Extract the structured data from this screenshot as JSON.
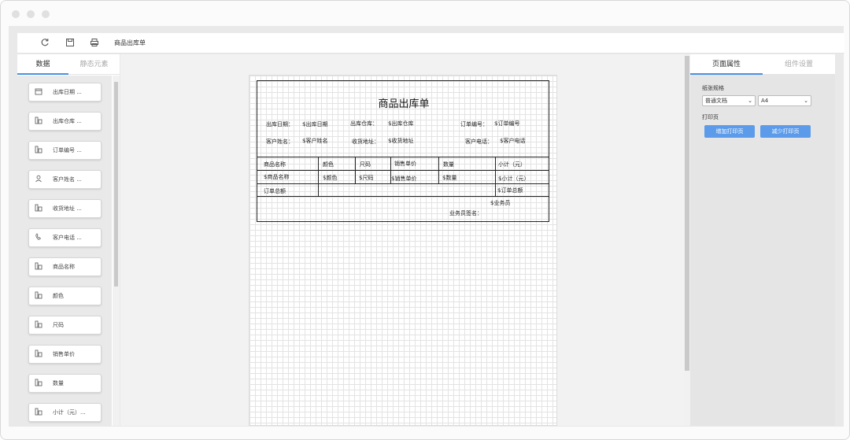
{
  "toolbar": {
    "title": "商品出库单",
    "icons": [
      "refresh-icon",
      "save-icon",
      "print-icon"
    ]
  },
  "left_tabs": [
    "数据",
    "静态元素"
  ],
  "data_items": [
    {
      "icon": "calendar-icon",
      "label": "出库日期 ..."
    },
    {
      "icon": "field-icon",
      "label": "出库仓库 ..."
    },
    {
      "icon": "field-icon",
      "label": "订单编号 ..."
    },
    {
      "icon": "user-icon",
      "label": "客户姓名 ..."
    },
    {
      "icon": "field-icon",
      "label": "收货地址 ..."
    },
    {
      "icon": "phone-icon",
      "label": "客户电话 ..."
    },
    {
      "icon": "field-icon",
      "label": "商品名称"
    },
    {
      "icon": "field-icon",
      "label": "颜色"
    },
    {
      "icon": "field-icon",
      "label": "尺码"
    },
    {
      "icon": "field-icon",
      "label": "销售单价"
    },
    {
      "icon": "field-icon",
      "label": "数量"
    },
    {
      "icon": "field-icon",
      "label": "小计（元）..."
    }
  ],
  "form": {
    "title": "商品出库单",
    "info": {
      "date_label": "出库日期：",
      "date_value": "$出库日期",
      "warehouse_label": "出库仓库：",
      "warehouse_value": "$出库仓库",
      "order_label": "订单编号：",
      "order_value": "$订单编号",
      "customer_label": "客户姓名：",
      "customer_value": "$客户姓名",
      "address_label": "收货地址：",
      "address_value": "$收货地址",
      "phone_label": "客户电话：",
      "phone_value": "$客户电话"
    },
    "table_headers": [
      "商品名称",
      "颜色",
      "尺码",
      "销售单价",
      "数量",
      "小计（元）"
    ],
    "table_row": [
      "$商品名称",
      "$颜色",
      "$尺码",
      "$销售单价",
      "$数量",
      "$小计（元）"
    ],
    "total_label": "订单总额",
    "total_value": "$订单总额",
    "salesman_value": "$业务员",
    "salesman_label": "业务员签名："
  },
  "right_tabs": [
    "页面属性",
    "组件设置"
  ],
  "page_props": {
    "paper_label": "纸张规格",
    "paper_type": "普通文档",
    "paper_size": "A4",
    "print_label": "打印页",
    "add_button": "增加打印页",
    "remove_button": "减少打印页"
  },
  "colors": {
    "accent": "#4a90e2",
    "button": "#5b9bea"
  }
}
